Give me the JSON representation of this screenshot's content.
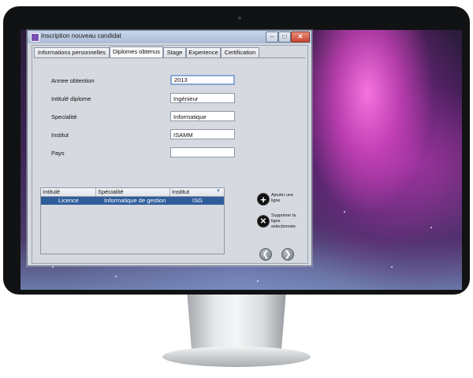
{
  "window": {
    "title": "Inscription nouveau candidat",
    "buttons": {
      "minimize": "–",
      "maximize": "□",
      "close": "✕"
    }
  },
  "tabs": [
    {
      "label": "Informations personnelles",
      "selected": false
    },
    {
      "label": "Diplomes obtenus",
      "selected": true
    },
    {
      "label": "Stage",
      "selected": false
    },
    {
      "label": "Experience",
      "selected": false
    },
    {
      "label": "Certification",
      "selected": false
    }
  ],
  "form": {
    "annee": {
      "label": "Annee obtention",
      "value": "2013"
    },
    "intitule": {
      "label": "Intitulé diplome",
      "value": "Ingénieur"
    },
    "specialite": {
      "label": "Specialité",
      "value": "Informatique"
    },
    "institut": {
      "label": "Institut",
      "value": "ISAMM"
    },
    "pays": {
      "label": "Pays",
      "value": ""
    }
  },
  "table": {
    "columns": [
      "Intitulé",
      "Spécialité",
      "Institut"
    ],
    "rows": [
      {
        "intitule": "Licence",
        "specialite": "Informatique de gestion",
        "institut": "ISG",
        "selected": true
      }
    ]
  },
  "actions": {
    "add": {
      "label": "Ajouter une ligne",
      "icon": "plus-circle-icon",
      "glyph": "+"
    },
    "delete": {
      "label": "Supprimer la ligne selectionnée",
      "icon": "x-circle-icon",
      "glyph": "✕"
    }
  },
  "navigation": {
    "previous": "❮",
    "next": "❯"
  },
  "colors": {
    "selection": "#2f5d9b",
    "accent": "#86a8d6"
  }
}
